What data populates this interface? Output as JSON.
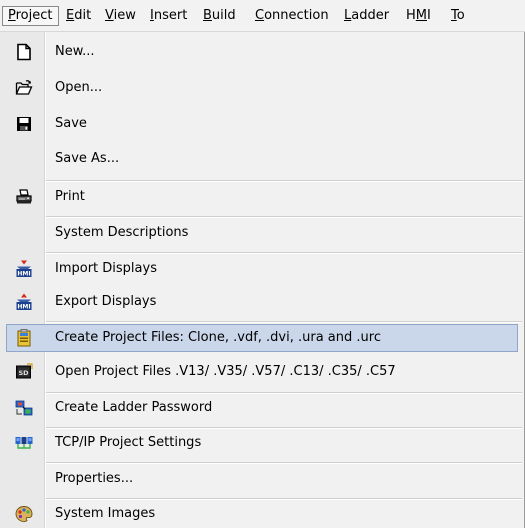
{
  "menubar": {
    "items": [
      {
        "label": "Project",
        "mnemonic": "P"
      },
      {
        "label": "Edit",
        "mnemonic": "E"
      },
      {
        "label": "View",
        "mnemonic": "V"
      },
      {
        "label": "Insert",
        "mnemonic": "I"
      },
      {
        "label": "Build",
        "mnemonic": "B"
      },
      {
        "label": "Connection",
        "mnemonic": "C"
      },
      {
        "label": "Ladder",
        "mnemonic": "L"
      },
      {
        "label": "HMI",
        "mnemonic": "M"
      },
      {
        "label": "To",
        "mnemonic": "T"
      }
    ]
  },
  "menu": {
    "items": [
      {
        "label": "New...",
        "icon": "new-file-icon"
      },
      {
        "label": "Open...",
        "icon": "open-folder-icon"
      },
      {
        "label": "Save",
        "icon": "save-disk-icon"
      },
      {
        "label": "Save As...",
        "icon": ""
      },
      {
        "label": "Print",
        "icon": "printer-icon"
      },
      {
        "label": "System Descriptions",
        "icon": ""
      },
      {
        "label": "Import Displays",
        "icon": "hmi-import-icon"
      },
      {
        "label": "Export Displays",
        "icon": "hmi-export-icon"
      },
      {
        "label": "Create Project Files: Clone, .vdf, .dvi, .ura and .urc",
        "icon": "create-project-files-icon",
        "highlighted": true
      },
      {
        "label": "Open Project Files .V13/ .V35/ .V57/  .C13/ .C35/ .C57",
        "icon": "open-project-files-icon"
      },
      {
        "label": "Create Ladder Password",
        "icon": "ladder-password-icon"
      },
      {
        "label": "TCP/IP Project Settings",
        "icon": "tcpip-settings-icon"
      },
      {
        "label": "Properties...",
        "icon": ""
      },
      {
        "label": "System Images",
        "icon": "system-images-icon"
      }
    ]
  },
  "colors": {
    "highlight": "#cad7eb",
    "highlight_border": "#8fa6c8",
    "menu_bg": "#f1f1f1",
    "hmi_blue": "#1a3f8f",
    "hmi_red": "#d42a1a"
  }
}
